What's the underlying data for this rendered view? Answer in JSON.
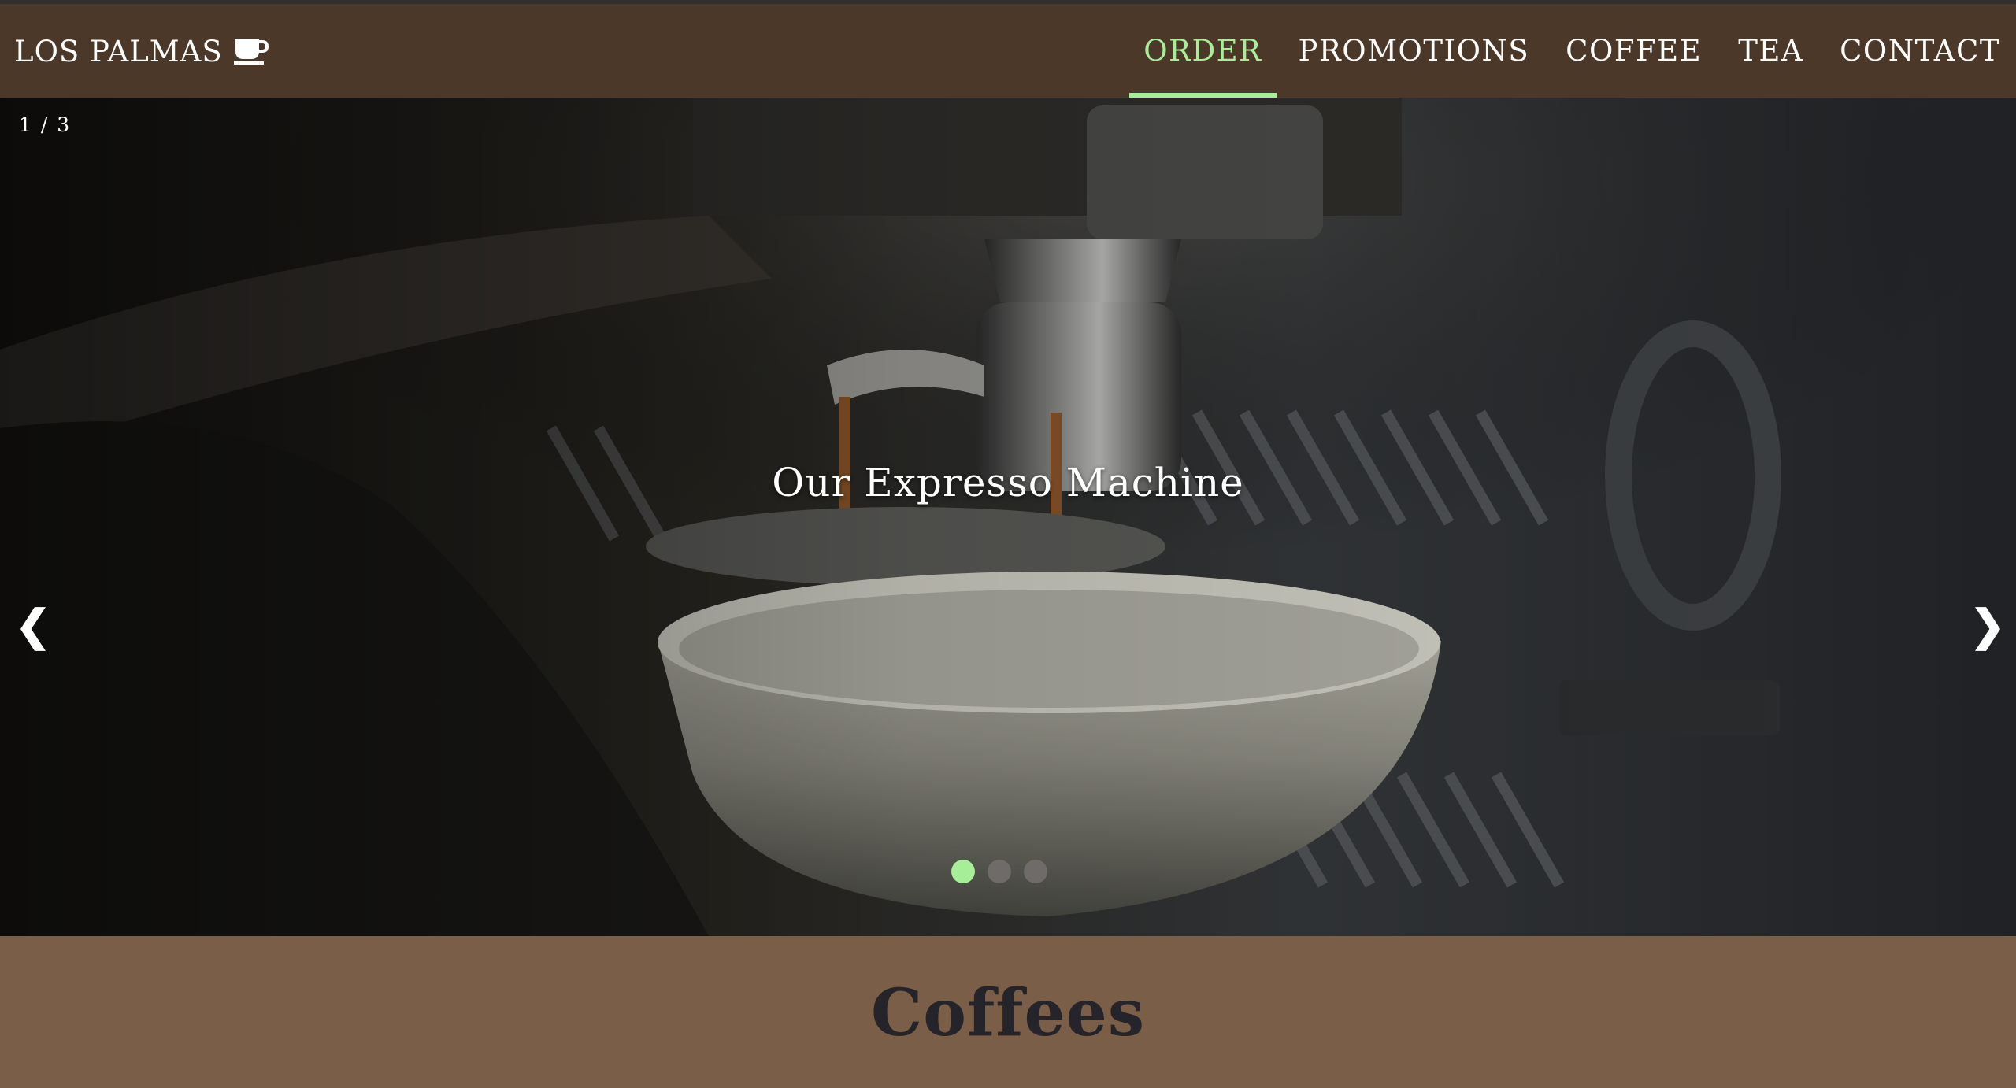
{
  "navbar": {
    "brand": "LOS PALMAS",
    "brand_icon": "coffee-cup-icon",
    "items": [
      {
        "label": "ORDER",
        "active": true
      },
      {
        "label": "PROMOTIONS",
        "active": false
      },
      {
        "label": "COFFEE",
        "active": false
      },
      {
        "label": "TEA",
        "active": false
      },
      {
        "label": "CONTACT",
        "active": false
      }
    ]
  },
  "slideshow": {
    "counter": "1 / 3",
    "caption": "Our Expresso Machine",
    "prev_icon": "chevron-left-icon",
    "next_icon": "chevron-right-icon",
    "prev_glyph": "❮",
    "next_glyph": "❯",
    "slide_count": 3,
    "current_slide": 1
  },
  "section": {
    "title": "Coffees"
  },
  "colors": {
    "navbar_bg": "#4c3829",
    "accent": "#a6ef98",
    "section_bg": "#7b5e47",
    "section_title": "#25242a",
    "dot_inactive": "#6e6b68"
  }
}
